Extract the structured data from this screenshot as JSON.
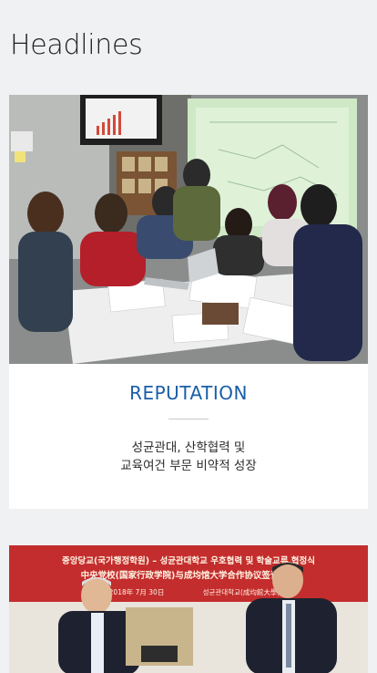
{
  "section": {
    "title": "Headlines"
  },
  "cards": [
    {
      "category": "REPUTATION",
      "description_lines": [
        "성균관대, 산학협력 및",
        "교육여건 부문 비약적 성장"
      ]
    },
    {
      "banner": {
        "line1": "중앙당교(국가행정학원) – 성균관대학교 우호협력 및 학술교류 협정식",
        "line2": "中央党校(国家行政学院)与成均馆大学合作协议签订仪式",
        "date": "2018年 7月 30日",
        "place": "성균관대학교(成均館大學)"
      }
    }
  ]
}
